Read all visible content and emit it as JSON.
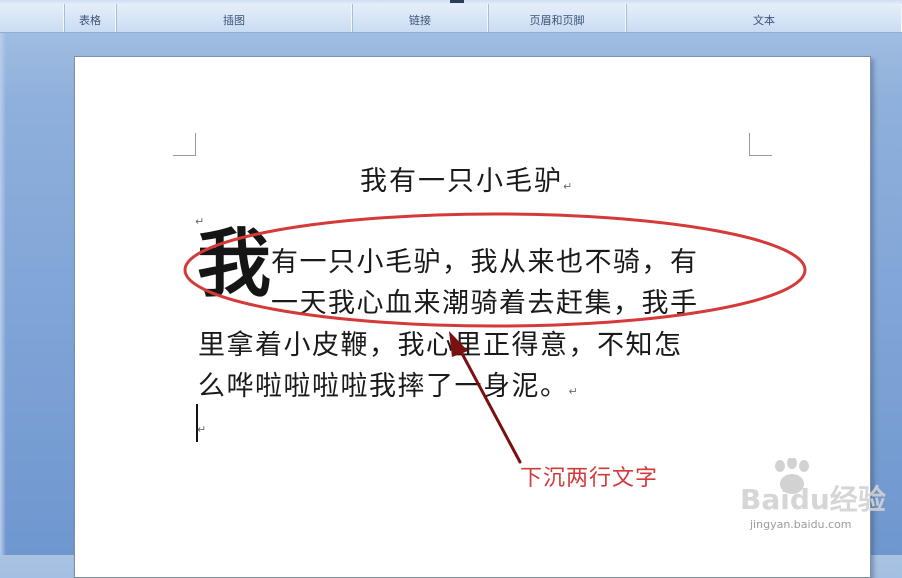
{
  "ribbon": {
    "groups": [
      {
        "label": ""
      },
      {
        "label": "表格"
      },
      {
        "label": "插图"
      },
      {
        "label": "链接"
      },
      {
        "label": "页眉和页脚"
      },
      {
        "label": "文本"
      }
    ]
  },
  "document": {
    "title": "我有一只小毛驴",
    "paragraph_mark": "↵",
    "dropcap": "我",
    "lines": [
      "有一只小毛驴，我从来也不骑，有",
      "一天我心血来潮骑着去赶集，我手",
      "里拿着小皮鞭，我心里正得意，不知怎",
      "么哗啦啦啦啦我摔了一身泥。"
    ]
  },
  "annotation": {
    "label": "下沉两行文字",
    "color": "#d43a3a"
  },
  "watermark": {
    "brand": "Baidu经验",
    "url": "jingyan.baidu.com"
  }
}
